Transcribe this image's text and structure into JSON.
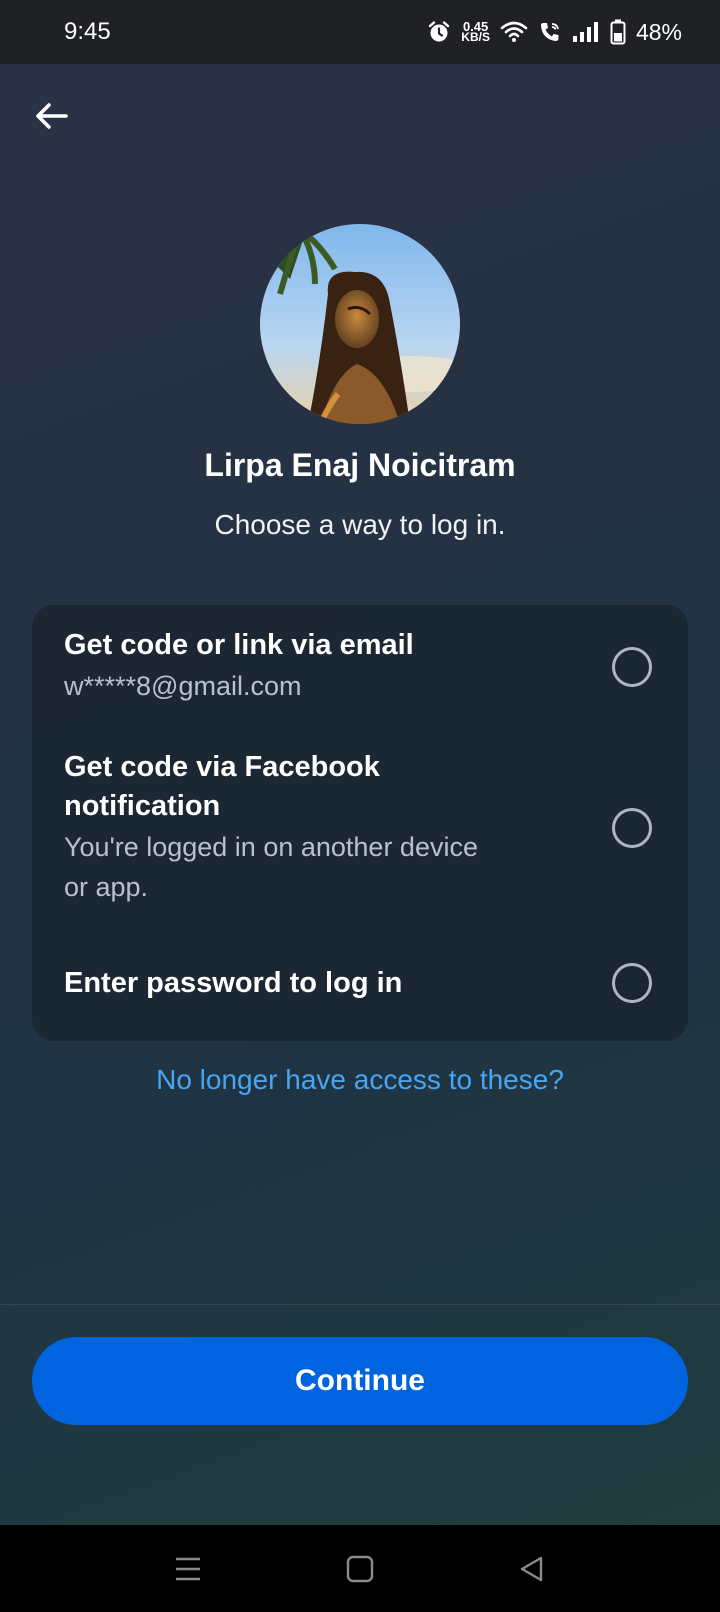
{
  "status_bar": {
    "time": "9:45",
    "net_speed_value": "0.45",
    "net_speed_unit": "KB/S",
    "battery": "48%",
    "icons": [
      "alarm-icon",
      "wifi-icon",
      "wifi-calling-icon",
      "signal-icon",
      "battery-icon"
    ]
  },
  "header": {
    "back_icon": "arrow-left-icon"
  },
  "profile": {
    "name": "Lirpa Enaj Noicitram",
    "subtitle": "Choose a way to log in."
  },
  "options": [
    {
      "title": "Get code or link via email",
      "subtitle": "w*****8@gmail.com",
      "selected": false
    },
    {
      "title_line1": "Get code via Facebook",
      "title_line2": "notification",
      "subtitle_line1": "You're logged in on another device",
      "subtitle_line2": "or app.",
      "selected": false
    },
    {
      "title": "Enter password to log in",
      "selected": false
    }
  ],
  "no_access_link": "No longer have access to these?",
  "continue_label": "Continue",
  "nav_bar": {
    "icons": [
      "menu-icon",
      "home-icon",
      "back-icon"
    ]
  },
  "colors": {
    "accent": "#0064e0",
    "link": "#4aa4f2"
  }
}
